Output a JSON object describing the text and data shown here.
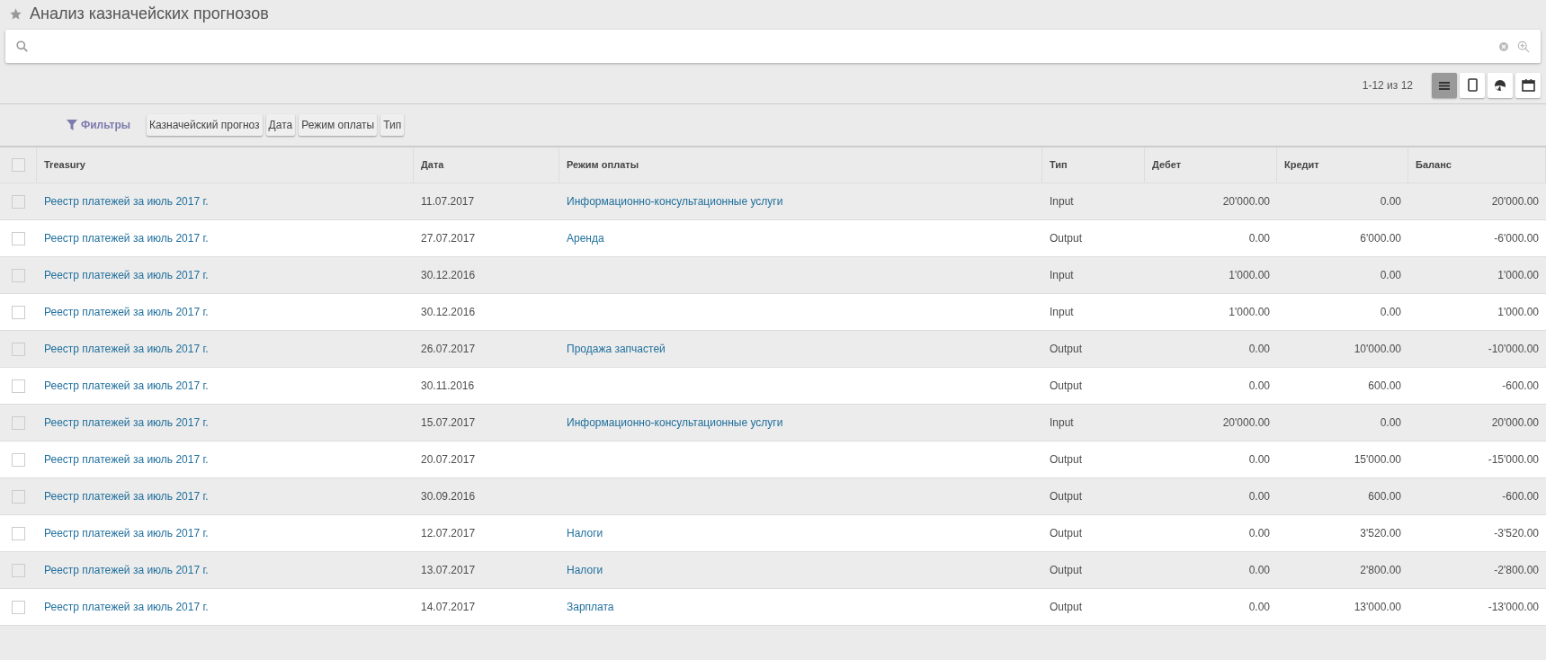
{
  "title": "Анализ казначейских прогнозов",
  "select_all": {
    "checked": false
  },
  "pager": "1-12 из 12",
  "views": [
    {
      "kind": "list",
      "selected": true
    },
    {
      "kind": "form",
      "selected": false
    },
    {
      "kind": "graph",
      "selected": false
    },
    {
      "kind": "calendar",
      "selected": false
    }
  ],
  "filters_label": "Фильтры",
  "groupby": [
    "Казначейский прогноз",
    "Дата",
    "Режим оплаты",
    "Тип"
  ],
  "table": {
    "columns": [
      "Treasury",
      "Дата",
      "Режим оплаты",
      "Тип",
      "Дебет",
      "Кредит",
      "Баланс"
    ],
    "rows": [
      {
        "treasury": "Реестр платежей за июль 2017 г.",
        "date": "11.07.2017",
        "mode": "Информационно-консультационные услуги",
        "type": "Input",
        "debit": "20'000.00",
        "credit": "0.00",
        "balance": "20'000.00",
        "checked": false
      },
      {
        "treasury": "Реестр платежей за июль 2017 г.",
        "date": "27.07.2017",
        "mode": "Аренда",
        "type": "Output",
        "debit": "0.00",
        "credit": "6'000.00",
        "balance": "-6'000.00",
        "checked": false
      },
      {
        "treasury": "Реестр платежей за июль 2017 г.",
        "date": "30.12.2016",
        "mode": "",
        "type": "Input",
        "debit": "1'000.00",
        "credit": "0.00",
        "balance": "1'000.00",
        "checked": false
      },
      {
        "treasury": "Реестр платежей за июль 2017 г.",
        "date": "30.12.2016",
        "mode": "",
        "type": "Input",
        "debit": "1'000.00",
        "credit": "0.00",
        "balance": "1'000.00",
        "checked": false
      },
      {
        "treasury": "Реестр платежей за июль 2017 г.",
        "date": "26.07.2017",
        "mode": "Продажа запчастей",
        "type": "Output",
        "debit": "0.00",
        "credit": "10'000.00",
        "balance": "-10'000.00",
        "checked": false
      },
      {
        "treasury": "Реестр платежей за июль 2017 г.",
        "date": "30.11.2016",
        "mode": "",
        "type": "Output",
        "debit": "0.00",
        "credit": "600.00",
        "balance": "-600.00",
        "checked": false
      },
      {
        "treasury": "Реестр платежей за июль 2017 г.",
        "date": "15.07.2017",
        "mode": "Информационно-консультационные услуги",
        "type": "Input",
        "debit": "20'000.00",
        "credit": "0.00",
        "balance": "20'000.00",
        "checked": false
      },
      {
        "treasury": "Реестр платежей за июль 2017 г.",
        "date": "20.07.2017",
        "mode": "",
        "type": "Output",
        "debit": "0.00",
        "credit": "15'000.00",
        "balance": "-15'000.00",
        "checked": false
      },
      {
        "treasury": "Реестр платежей за июль 2017 г.",
        "date": "30.09.2016",
        "mode": "",
        "type": "Output",
        "debit": "0.00",
        "credit": "600.00",
        "balance": "-600.00",
        "checked": false
      },
      {
        "treasury": "Реестр платежей за июль 2017 г.",
        "date": "12.07.2017",
        "mode": "Налоги",
        "type": "Output",
        "debit": "0.00",
        "credit": "3'520.00",
        "balance": "-3'520.00",
        "checked": false
      },
      {
        "treasury": "Реестр платежей за июль 2017 г.",
        "date": "13.07.2017",
        "mode": "Налоги",
        "type": "Output",
        "debit": "0.00",
        "credit": "2'800.00",
        "balance": "-2'800.00",
        "checked": false
      },
      {
        "treasury": "Реестр платежей за июль 2017 г.",
        "date": "14.07.2017",
        "mode": "Зарплата",
        "type": "Output",
        "debit": "0.00",
        "credit": "13'000.00",
        "balance": "-13'000.00",
        "checked": false
      }
    ]
  }
}
